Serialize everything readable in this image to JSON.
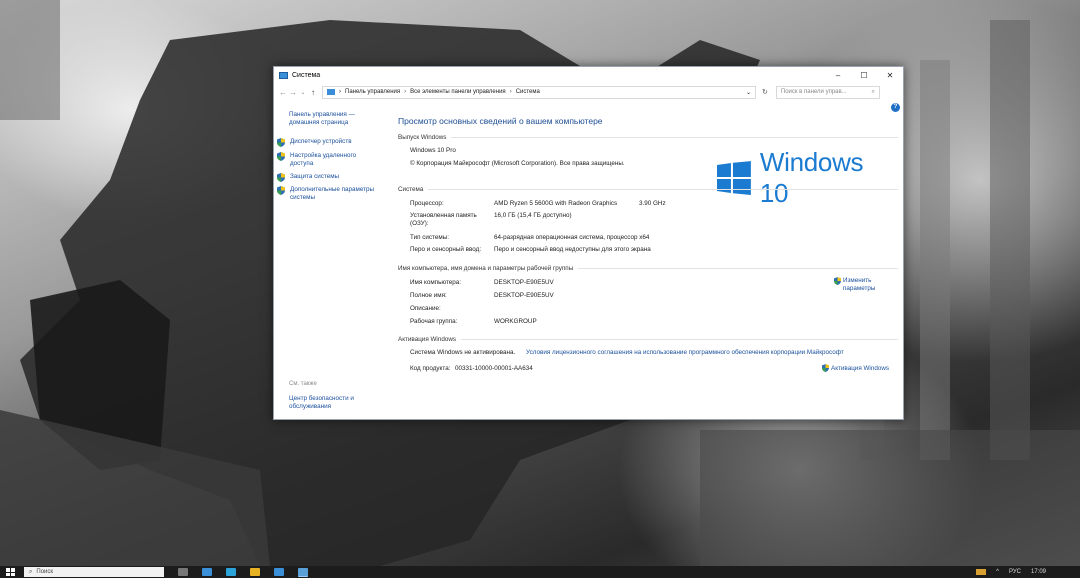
{
  "window": {
    "title": "Система",
    "controls": {
      "minimize": "–",
      "maximize": "☐",
      "close": "✕"
    }
  },
  "address": {
    "crumbs": [
      "Панель управления",
      "Все элементы панели управления",
      "Система"
    ],
    "search_placeholder": "Поиск в панели управ..."
  },
  "left_pane": {
    "home_link": "Панель управления — домашняя страница",
    "items": [
      {
        "label": "Диспетчер устройств",
        "icon": "shield-icon"
      },
      {
        "label": "Настройка удаленного доступа",
        "icon": "shield-icon"
      },
      {
        "label": "Защита системы",
        "icon": "shield-icon"
      },
      {
        "label": "Дополнительные параметры системы",
        "icon": "shield-icon"
      }
    ],
    "see_also": "См. также",
    "security_link": "Центр безопасности и обслуживания"
  },
  "main": {
    "page_title": "Просмотр основных сведений о вашем компьютере",
    "edition": {
      "heading": "Выпуск Windows",
      "name": "Windows 10 Pro",
      "copyright": "© Корпорация Майкрософт (Microsoft Corporation). Все права защищены.",
      "logo_text": "Windows 10"
    },
    "system": {
      "heading": "Система",
      "processor_label": "Процессор:",
      "processor_value": "AMD Ryzen 5 5600G with Radeon Graphics",
      "processor_speed": "3.90 GHz",
      "ram_label": "Установленная память (ОЗУ):",
      "ram_value": "16,0 ГБ (15,4 ГБ доступно)",
      "type_label": "Тип системы:",
      "type_value": "64-разрядная операционная система, процессор x64",
      "pen_label": "Перо и сенсорный ввод:",
      "pen_value": "Перо и сенсорный ввод недоступны для этого экрана"
    },
    "computer": {
      "heading": "Имя компьютера, имя домена и параметры рабочей группы",
      "name_label": "Имя компьютера:",
      "name_value": "DESKTOP-E90E5UV",
      "full_label": "Полное имя:",
      "full_value": "DESKTOP-E90E5UV",
      "desc_label": "Описание:",
      "desc_value": "",
      "wg_label": "Рабочая группа:",
      "wg_value": "WORKGROUP",
      "change_link": "Изменить параметры"
    },
    "activation": {
      "heading": "Активация Windows",
      "status_label": "Система Windows не активирована.",
      "license_link": "Условия лицензионного соглашения на использование программного обеспечения корпорации Майкрософт",
      "product_label": "Код продукта:",
      "product_value": "00331-10000-00001-AA634",
      "activate_link": "Активация Windows"
    }
  },
  "taskbar": {
    "search_text": "Поиск",
    "lang": "РУС",
    "time": "17:09"
  },
  "colors": {
    "link": "#1a4f9c",
    "title": "#1e4e94",
    "windows_blue": "#1a7bd1",
    "help": "#1f6fc5"
  }
}
